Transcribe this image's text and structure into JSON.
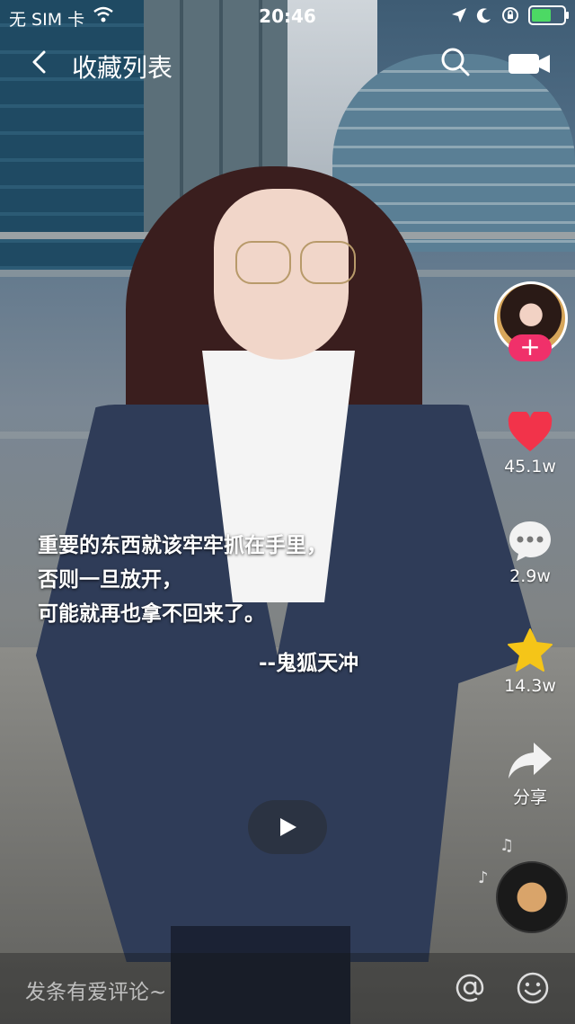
{
  "status_bar": {
    "carrier": "无 SIM 卡",
    "time": "20:46"
  },
  "nav": {
    "title": "收藏列表"
  },
  "sidebar": {
    "likes": "45.1w",
    "comments": "2.9w",
    "favorites": "14.3w",
    "share_label": "分享"
  },
  "quote": {
    "lines": [
      "重要的东西就该牢牢抓在手里，",
      "否则一旦放开，",
      "可能就再也拿不回来了。"
    ],
    "author": "--鬼狐天冲"
  },
  "comment_bar": {
    "placeholder": "发条有爱评论~"
  },
  "colors": {
    "like_red": "#f2334a",
    "star_gold": "#f5c518",
    "follow_pink": "#f0306a"
  }
}
